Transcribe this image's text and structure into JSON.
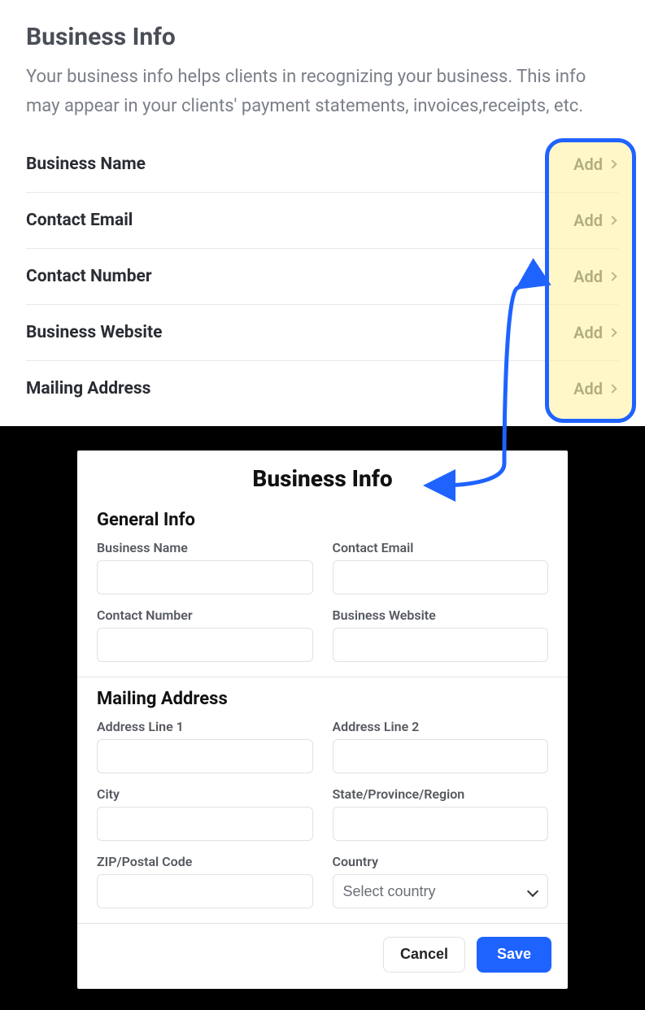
{
  "top": {
    "title": "Business Info",
    "desc": "Your business info helps clients in recognizing your business. This info may appear in your clients' payment statements, invoices,receipts, etc.",
    "add_label": "Add",
    "rows": [
      {
        "label": "Business Name"
      },
      {
        "label": "Contact Email"
      },
      {
        "label": "Contact Number"
      },
      {
        "label": "Business Website"
      },
      {
        "label": "Mailing Address"
      }
    ]
  },
  "form": {
    "title": "Business Info",
    "sections": {
      "general": {
        "title": "General Info",
        "fields": {
          "business_name": {
            "label": "Business Name",
            "value": ""
          },
          "contact_email": {
            "label": "Contact Email",
            "value": ""
          },
          "contact_number": {
            "label": "Contact Number",
            "value": ""
          },
          "business_website": {
            "label": "Business Website",
            "value": ""
          }
        }
      },
      "mailing": {
        "title": "Mailing Address",
        "fields": {
          "address1": {
            "label": "Address Line 1",
            "value": ""
          },
          "address2": {
            "label": "Address Line 2",
            "value": ""
          },
          "city": {
            "label": "City",
            "value": ""
          },
          "state": {
            "label": "State/Province/Region",
            "value": ""
          },
          "zip": {
            "label": "ZIP/Postal Code",
            "value": ""
          },
          "country": {
            "label": "Country",
            "placeholder": "Select country",
            "value": ""
          }
        }
      }
    },
    "buttons": {
      "cancel": "Cancel",
      "save": "Save"
    }
  }
}
